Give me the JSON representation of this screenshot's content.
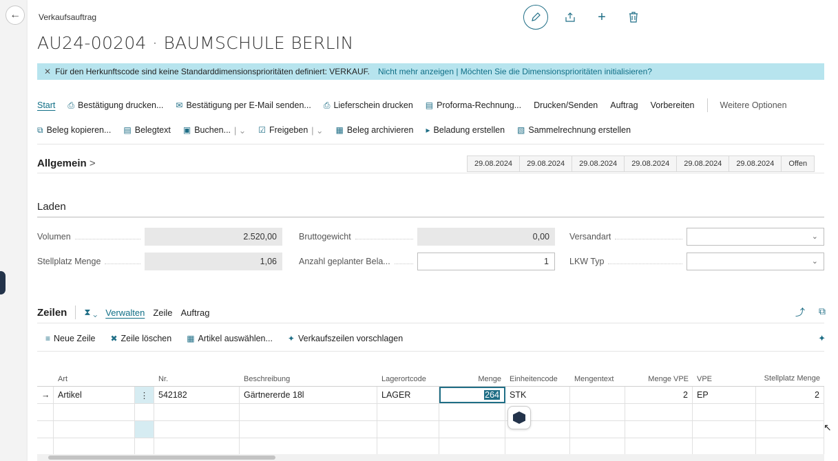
{
  "breadcrumb": "Verkaufsauftrag",
  "title": "AU24-00204 · BAUMSCHULE BERLIN",
  "banner": {
    "message": "Für den Herkunftscode sind keine Standarddimensionsprioritäten definiert: VERKAUF.",
    "link": "Nicht mehr anzeigen | Möchten Sie die Dimensionsprioritäten initialisieren?"
  },
  "actions1": {
    "start": "Start",
    "print_confirm": "Bestätigung drucken...",
    "email_confirm": "Bestätigung per E-Mail senden...",
    "print_delivery": "Lieferschein drucken",
    "proforma": "Proforma-Rechnung...",
    "print_send": "Drucken/Senden",
    "order": "Auftrag",
    "prepare": "Vorbereiten",
    "more": "Weitere Optionen"
  },
  "actions2": {
    "copy_doc": "Beleg kopieren...",
    "doc_text": "Belegtext",
    "post": "Buchen...",
    "release": "Freigeben",
    "archive": "Beleg archivieren",
    "create_load": "Beladung erstellen",
    "collective_invoice": "Sammelrechnung erstellen"
  },
  "general": {
    "title": "Allgemein",
    "dates": [
      "29.08.2024",
      "29.08.2024",
      "29.08.2024",
      "29.08.2024",
      "29.08.2024",
      "29.08.2024"
    ],
    "status": "Offen"
  },
  "laden": {
    "title": "Laden",
    "volumen_label": "Volumen",
    "volumen_value": "2.520,00",
    "stellplatz_label": "Stellplatz Menge",
    "stellplatz_value": "1,06",
    "brutto_label": "Bruttogewicht",
    "brutto_value": "0,00",
    "anzahl_label": "Anzahl geplanter Bela...",
    "anzahl_value": "1",
    "versandart_label": "Versandart",
    "lkw_label": "LKW Typ"
  },
  "lines": {
    "title": "Zeilen",
    "manage": "Verwalten",
    "line": "Zeile",
    "order": "Auftrag",
    "new_line": "Neue Zeile",
    "delete_line": "Zeile löschen",
    "select_items": "Artikel auswählen...",
    "suggest": "Verkaufszeilen vorschlagen",
    "columns": {
      "art": "Art",
      "nr": "Nr.",
      "beschreibung": "Beschreibung",
      "lagerort": "Lagerortcode",
      "menge": "Menge",
      "einheit": "Einheitencode",
      "mengentext": "Mengentext",
      "menge_vpe": "Menge VPE",
      "vpe": "VPE",
      "stellplatz": "Stellplatz Menge"
    },
    "row1": {
      "art": "Artikel",
      "nr": "542182",
      "beschreibung": "Gärtnererde 18l",
      "lagerort": "LAGER",
      "menge": "264",
      "einheit": "STK",
      "mengentext": "",
      "menge_vpe": "2",
      "vpe": "EP",
      "stellplatz": "2"
    }
  }
}
